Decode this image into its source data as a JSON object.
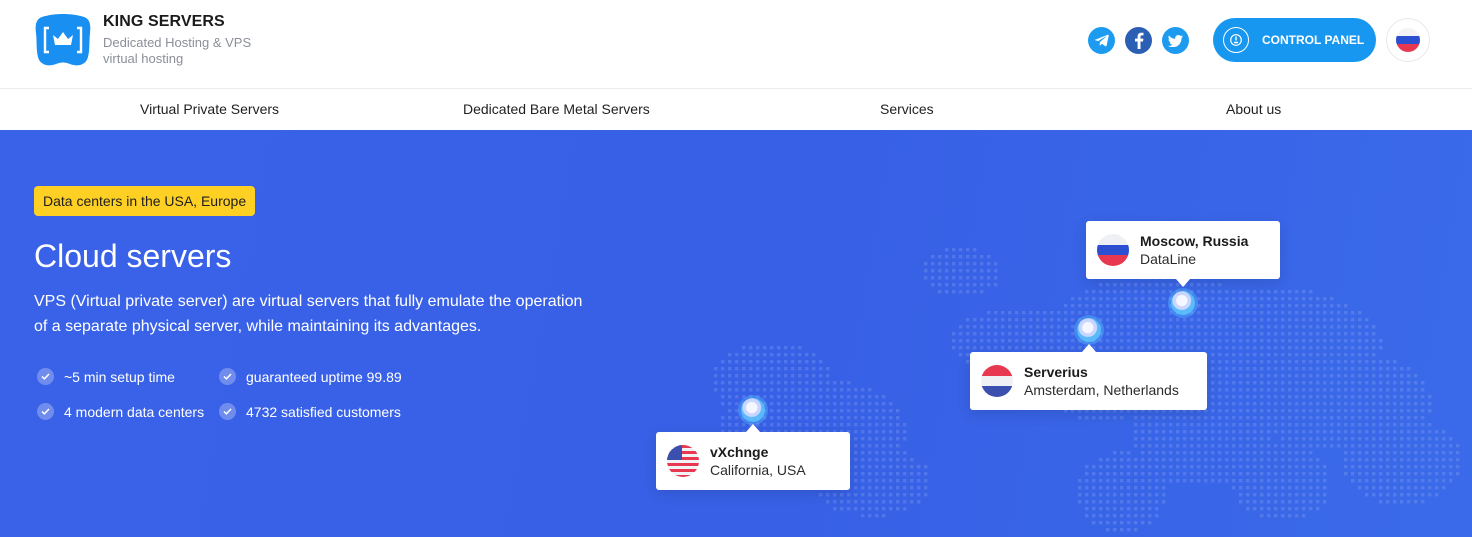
{
  "header": {
    "brand_name": "KING SERVERS",
    "brand_tagline": "Dedicated Hosting & VPS virtual hosting",
    "control_panel_label": "CONTROL PANEL",
    "social": [
      "telegram-icon",
      "facebook-icon",
      "twitter-icon"
    ],
    "language_flag": "russia-flag-icon"
  },
  "nav": {
    "items": [
      {
        "label": "Virtual Private Servers"
      },
      {
        "label": "Dedicated Bare Metal Servers"
      },
      {
        "label": "Services"
      },
      {
        "label": "About us"
      }
    ]
  },
  "hero": {
    "badge": "Data centers in the USA, Europe",
    "title": "Cloud servers",
    "description": "VPS (Virtual private server) are virtual servers that fully emulate the operation of a separate physical server, while maintaining its advantages.",
    "features": [
      {
        "label": "~5 min setup time"
      },
      {
        "label": "guaranteed uptime 99.89"
      },
      {
        "label": "4 modern data centers"
      },
      {
        "label": "4732 satisfied customers"
      }
    ]
  },
  "datacenters": [
    {
      "name": "Moscow, Russia",
      "provider": "DataLine",
      "flag": "russia-flag"
    },
    {
      "name": "Serverius",
      "provider": "Amsterdam, Netherlands",
      "flag": "netherlands-flag"
    },
    {
      "name": "vXchnge",
      "provider": "California, USA",
      "flag": "usa-flag"
    }
  ],
  "colors": {
    "hero_bg": "#3760e6",
    "accent": "#1897f0",
    "badge": "#ffd024"
  }
}
